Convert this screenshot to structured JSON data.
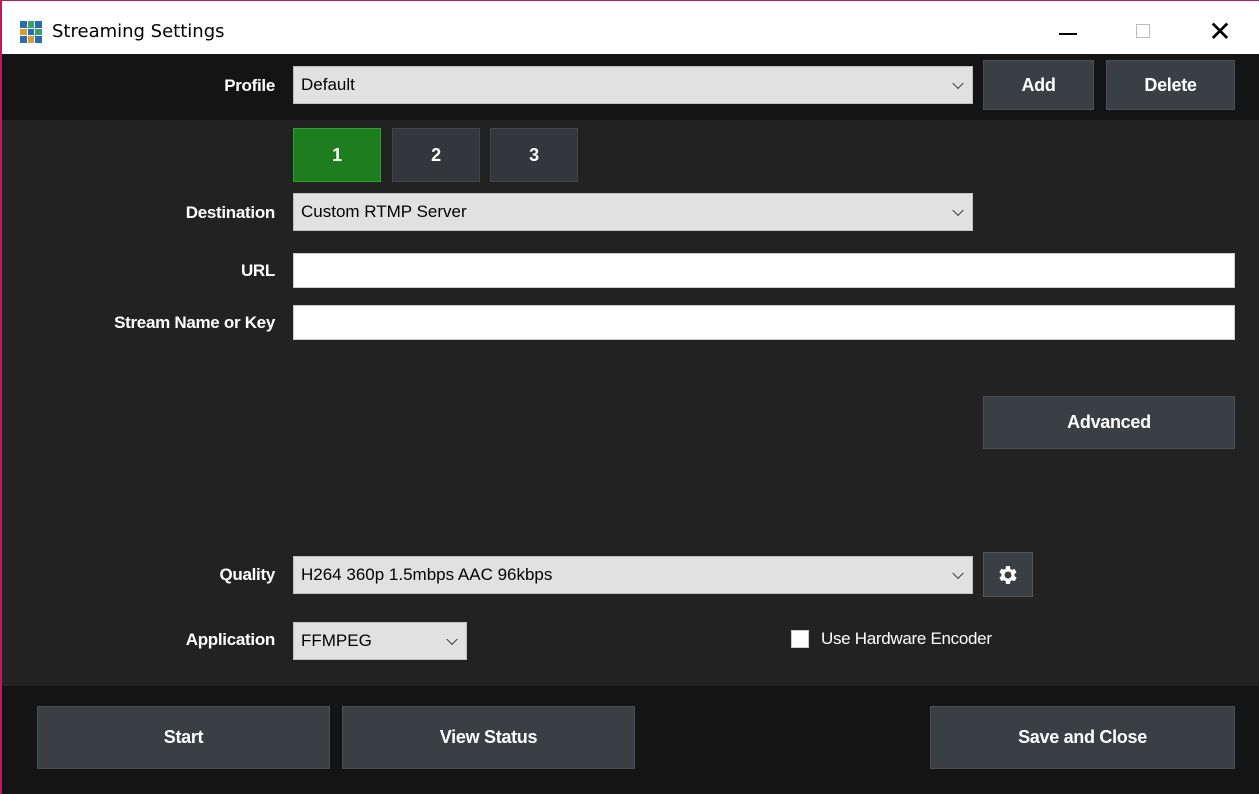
{
  "window": {
    "title": "Streaming Settings",
    "controls": {
      "minimize": "minimize",
      "maximize": "maximize",
      "close": "✕"
    },
    "accent_border": "#c2185b"
  },
  "profile": {
    "label": "Profile",
    "selected": "Default",
    "add_label": "Add",
    "delete_label": "Delete"
  },
  "tabs": [
    {
      "label": "1",
      "active": true
    },
    {
      "label": "2",
      "active": false
    },
    {
      "label": "3",
      "active": false
    }
  ],
  "destination": {
    "label": "Destination",
    "selected": "Custom RTMP Server"
  },
  "url": {
    "label": "URL",
    "value": "",
    "placeholder": ""
  },
  "stream_key": {
    "label": "Stream Name or Key",
    "value": "",
    "placeholder": ""
  },
  "advanced_label": "Advanced",
  "quality": {
    "label": "Quality",
    "selected": "H264 360p 1.5mbps AAC 96kbps",
    "settings_icon": "gear-icon"
  },
  "application": {
    "label": "Application",
    "selected": "FFMPEG"
  },
  "hardware_encoder": {
    "label": "Use Hardware Encoder",
    "checked": false
  },
  "footer": {
    "start_label": "Start",
    "view_status_label": "View Status",
    "save_close_label": "Save and Close"
  },
  "colors": {
    "active_tab": "#1e7d1e",
    "button_bg": "#3a3f44",
    "panel_bg": "#222222",
    "bar_bg": "#141414"
  }
}
